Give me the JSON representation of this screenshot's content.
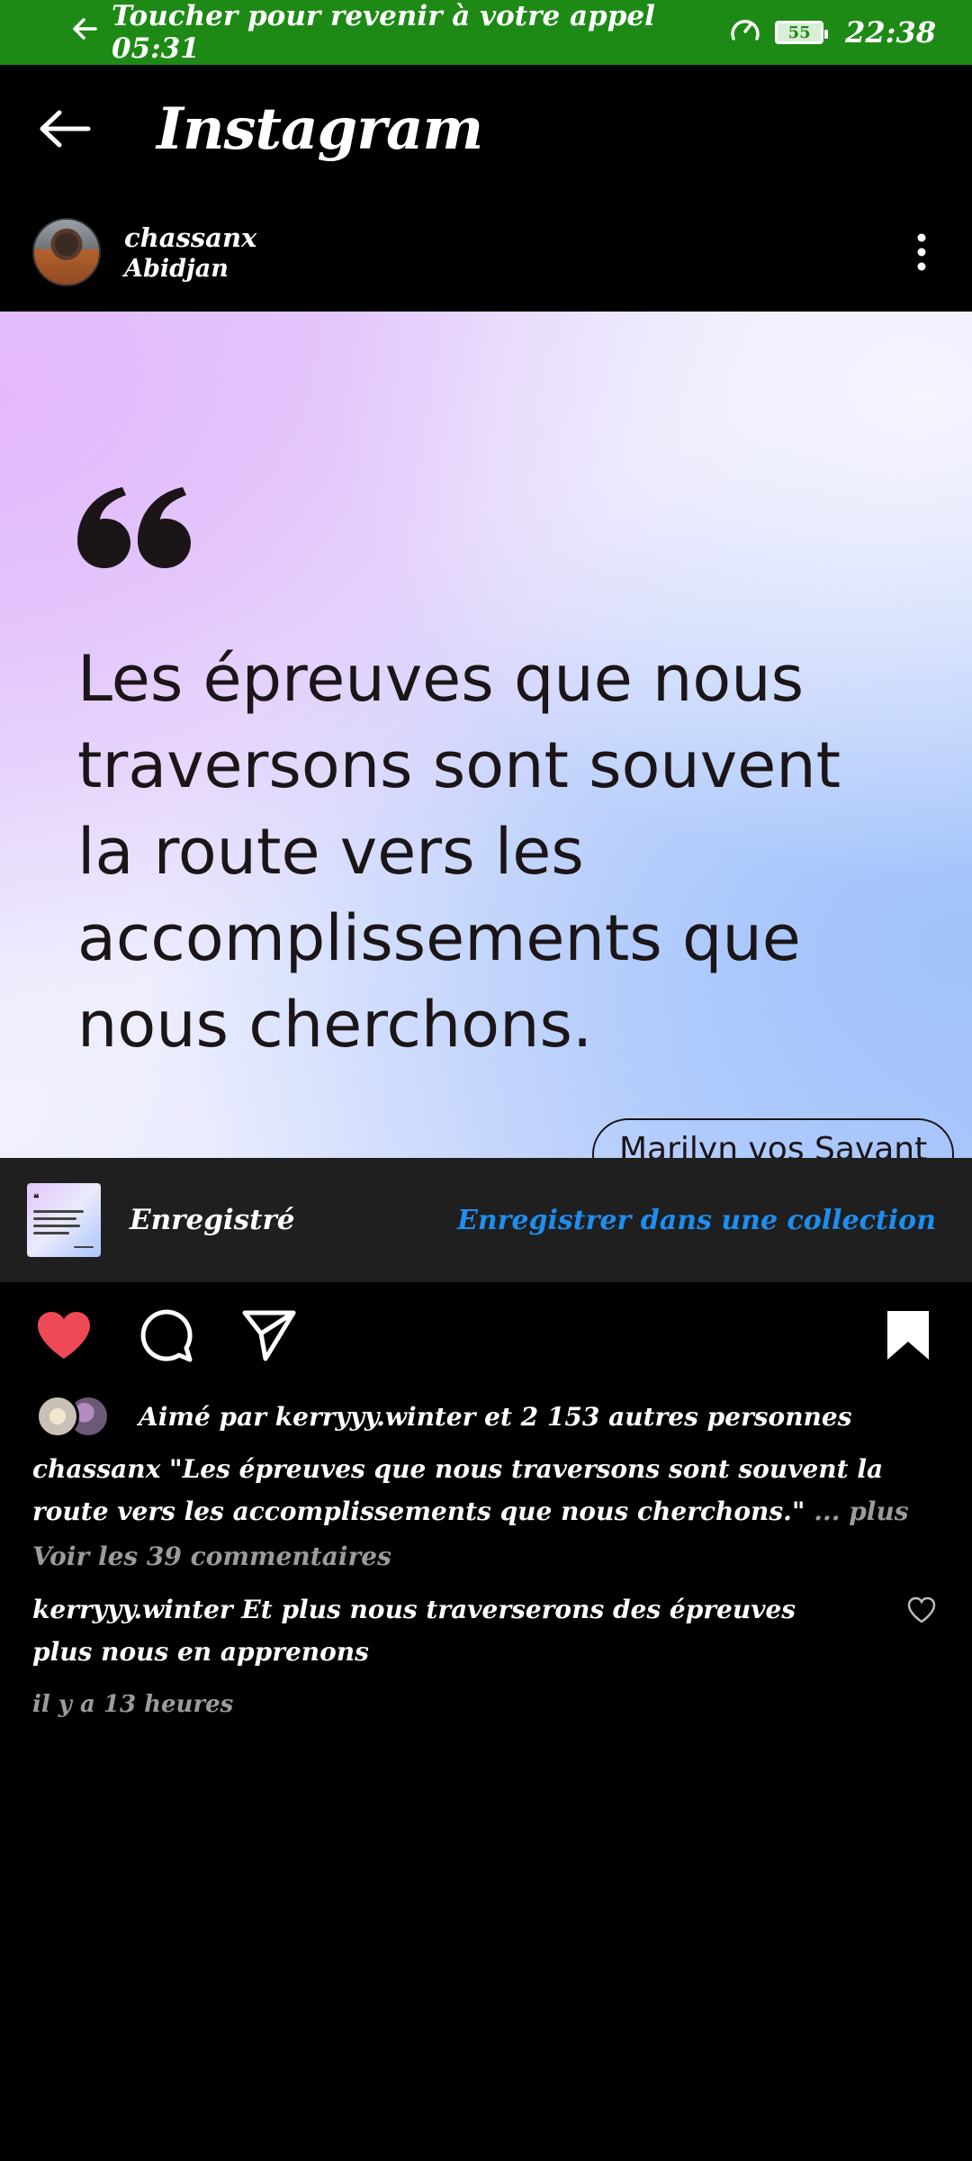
{
  "status_bar": {
    "call_back_text": "Toucher pour revenir à votre appel 05:31",
    "battery_level": "55",
    "time": "22:38",
    "background": "#1e8a16"
  },
  "header": {
    "brand": "Instagram"
  },
  "post": {
    "username": "chassanx",
    "location": "Abidjan",
    "image": {
      "quote_mark": "❝",
      "quote": "Les épreuves que nous traversons sont souvent la route vers les accomplissements que nous cherchons.",
      "author": "Marilyn vos Savant"
    },
    "saved_banner": {
      "label": "Enregistré",
      "action": "Enregistrer dans une collection",
      "action_color": "#1e8ef0"
    },
    "actions": {
      "liked": true,
      "saved": true,
      "like_color": "#ed4956"
    },
    "likes_text": "Aimé par kerryyy.winter et 2 153 autres personnes",
    "caption": {
      "username": "chassanx",
      "text": "\"Les épreuves que nous traversons sont souvent la route vers les accomplissements que nous cherchons.\"",
      "more": "... plus"
    },
    "view_comments": "Voir les 39 commentaires",
    "top_comment": {
      "username": "kerryyy.winter",
      "text": "Et plus nous traverserons des épreuves plus nous en apprenons"
    },
    "time_ago": "il y a 13 heures"
  }
}
